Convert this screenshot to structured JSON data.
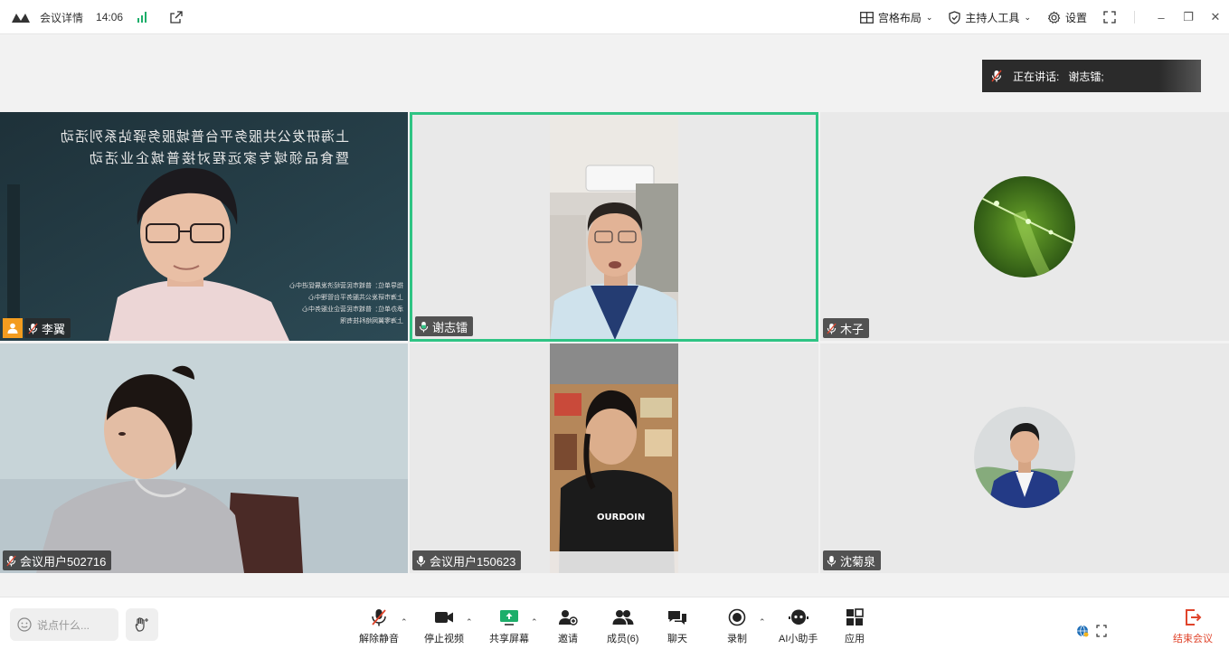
{
  "titlebar": {
    "title": "会议详情",
    "time": "14:06",
    "layout_label": "宫格布局",
    "host_tools_label": "主持人工具",
    "settings_label": "设置"
  },
  "speaking": {
    "label": "正在讲话:",
    "name": "谢志镭;"
  },
  "slide": {
    "line1": "上海研发公共服务平台普城服务驿站系列活动",
    "line2": "暨食品领域专家远程对接普城企业活动",
    "footer": [
      "指导单位：普城市民营经济发展促进中心",
      "上海市研发公共服务平台管理中心",
      "承办单位：普城市民营企业服务中心",
      "上海零翼网络科技有限"
    ]
  },
  "participants": [
    {
      "name": "李翼",
      "mic": "muted"
    },
    {
      "name": "谢志镭",
      "mic": "speaking"
    },
    {
      "name": "木子",
      "mic": "muted"
    },
    {
      "name": "会议用户502716",
      "mic": "muted"
    },
    {
      "name": "会议用户150623",
      "mic": "on"
    },
    {
      "name": "沈菊泉",
      "mic": "on"
    }
  ],
  "toolbar": {
    "chat_placeholder": "说点什么...",
    "unmute": "解除静音",
    "stop_video": "停止视频",
    "share_screen": "共享屏幕",
    "invite": "邀请",
    "members": "成员(6)",
    "chat": "聊天",
    "record": "录制",
    "ai_assistant": "AI小助手",
    "apps": "应用",
    "end_meeting": "结束会议"
  },
  "colors": {
    "active_border": "#2fc484",
    "end_red": "#e0442b",
    "signal_green": "#1cae6a"
  }
}
